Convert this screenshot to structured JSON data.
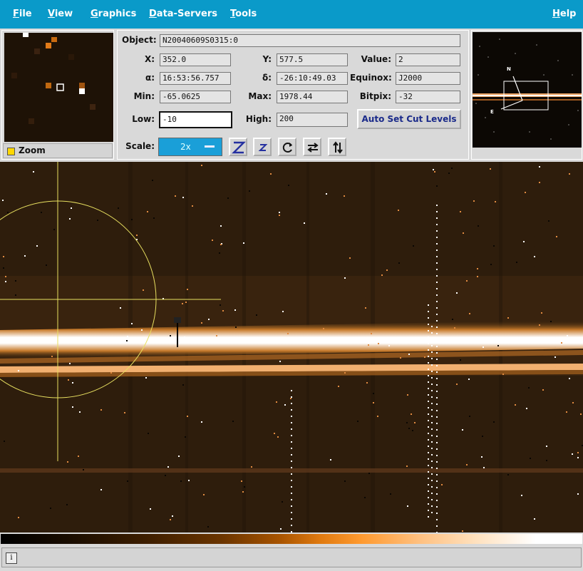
{
  "menubar": {
    "items": [
      {
        "label": "File",
        "key": "F"
      },
      {
        "label": "View",
        "key": "V"
      },
      {
        "label": "Graphics",
        "key": "G"
      },
      {
        "label": "Data-Servers",
        "key": "D"
      },
      {
        "label": "Tools",
        "key": "T"
      }
    ],
    "help": {
      "label": "Help",
      "key": "H"
    }
  },
  "zoom": {
    "toggle_label": "Zoom",
    "toggle_color": "#ffd700"
  },
  "info": {
    "object_label": "Object:",
    "object_value": "N20040609S0315:0",
    "x_label": "X:",
    "x_value": "352.0",
    "y_label": "Y:",
    "y_value": "577.5",
    "value_label": "Value:",
    "value_value": "2",
    "ra_label": "α:",
    "ra_value": "16:53:56.757",
    "dec_label": "δ:",
    "dec_value": "-26:10:49.03",
    "equinox_label": "Equinox:",
    "equinox_value": "J2000",
    "min_label": "Min:",
    "min_value": "-65.0625",
    "max_label": "Max:",
    "max_value": "1978.44",
    "bitpix_label": "Bitpix:",
    "bitpix_value": "-32",
    "low_label": "Low:",
    "low_value": "-10",
    "high_label": "High:",
    "high_value": "200",
    "auto_set_label": "Auto Set Cut Levels",
    "scale_label": "Scale:",
    "scale_value": "2x"
  },
  "toolbar_icons": [
    "zoom-in-icon",
    "zoom-out-icon",
    "rotate-icon",
    "flip-horizontal-icon",
    "flip-vertical-icon"
  ],
  "panner": {
    "north_label": "N",
    "east_label": "E"
  },
  "status": {
    "icon_text": "i",
    "message": ""
  },
  "colors": {
    "menubar": "#0a9ac9",
    "accent": "#1a9fd8",
    "overlay": "#e8e060"
  }
}
